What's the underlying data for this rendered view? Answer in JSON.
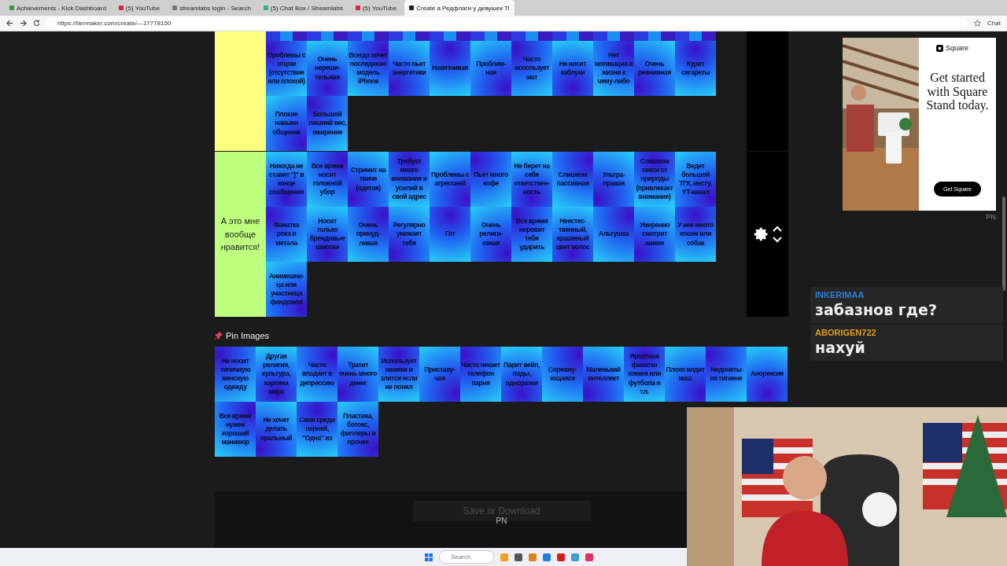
{
  "browser": {
    "tabs": [
      {
        "label": "Achievements - Kick Dashboard",
        "color": "#2e9e3e",
        "selected": false
      },
      {
        "label": "(5) YouTube",
        "color": "#e0203a",
        "selected": false
      },
      {
        "label": "streamlabs login - Search",
        "color": "#777777",
        "selected": false
      },
      {
        "label": "(5) Chat Box / Streamlabs",
        "color": "#3aa88a",
        "selected": false
      },
      {
        "label": "(5) YouTube",
        "color": "#e0203a",
        "selected": false
      },
      {
        "label": "Create a Редфлаги у девушек Ti",
        "color": "#222222",
        "selected": true
      }
    ],
    "url": "https://tiermaker.com/create/---17778150",
    "chat_button": "Chat"
  },
  "tiers": [
    {
      "color": "#ffff7f",
      "items": [
        "Проблемы с отцом (отсутствие или плохой)",
        "Очень нереши-тельная",
        "Всегда хочет последнюю модель iPhone",
        "Часто пьет энергетики",
        "Навязчивая",
        "Проблем-ная",
        "Часто использует мат",
        "Не носит каблуки",
        "Нет мотивации в жизни к чему-либо",
        "Очень ревнивная",
        "Курит сигареты",
        "Плохие навыки общения",
        "Большой лишний вес, ожирение"
      ]
    },
    {
      "label": "А это мне вообще нравится!",
      "color": "#bfff7f",
      "items": [
        "Никогда не ставит \")\" в конце сообщения",
        "Все время носит головной убор",
        "Стримит на твиче (одетая)",
        "Требует много внимания и усилий в свой адрес",
        "Проблемы с агрессией",
        "Пьет много кофе",
        "Не берет на себя ответствен-ность",
        "Слишком пассивная",
        "Ультра-правая",
        "Слишком секси от природы (привлекает внимание)",
        "Ведет большой ТГК, инсту, YT-канал",
        "Фанатка рока и метала",
        "Носит только брендовые шмотки",
        "Очень причуд-ливая",
        "Регулярно унижает тебя",
        "Гот",
        "Очень религи-озная",
        "Все время норовит тебя ударить",
        "Неестес-твенный, крашеный цвет волос",
        "Альтушка",
        "Умеренно смотрит аниме",
        "У нее много кошек или собак",
        "Анимешни-ца или участница фандомов"
      ]
    }
  ],
  "pin_images": {
    "title": "Pin Images",
    "items": [
      "Не носит типичную женскую одежду",
      "Другая религия, культура, картина мира",
      "Часто впадает в депрессию",
      "Тратит очень много денег",
      "Использует намеки и злится если не понял",
      "Приставу-чая",
      "Часто чекает телефон парня",
      "Парит вейп, поды, одноразки",
      "Соревну-ющаяся",
      "Маленький интеллект",
      "Яростная фанатка хоккея или футбола и т.п.",
      "Плохо водит маш",
      "Недочеты по гигиене",
      "Анорексия",
      "Все время нужен хороший маникюр",
      "Не хочет делать оральный",
      "Своя среди парней, \"Одна\" из",
      "Пластика, ботокс, филлеры и прочее"
    ]
  },
  "save": {
    "label": "Save or Download",
    "note": "PN"
  },
  "ad": {
    "brand": "Square",
    "headline": "Get started with Square Stand today.",
    "button": "Get Square",
    "note": "PN"
  },
  "chat": [
    {
      "user": "INKERIMAA",
      "color": "#2f7fd8",
      "message": "забазнов где?"
    },
    {
      "user": "ABORIGEN722",
      "color": "#e0a020",
      "message": "нахуй"
    }
  ],
  "taskbar": {
    "search_placeholder": "Search"
  }
}
